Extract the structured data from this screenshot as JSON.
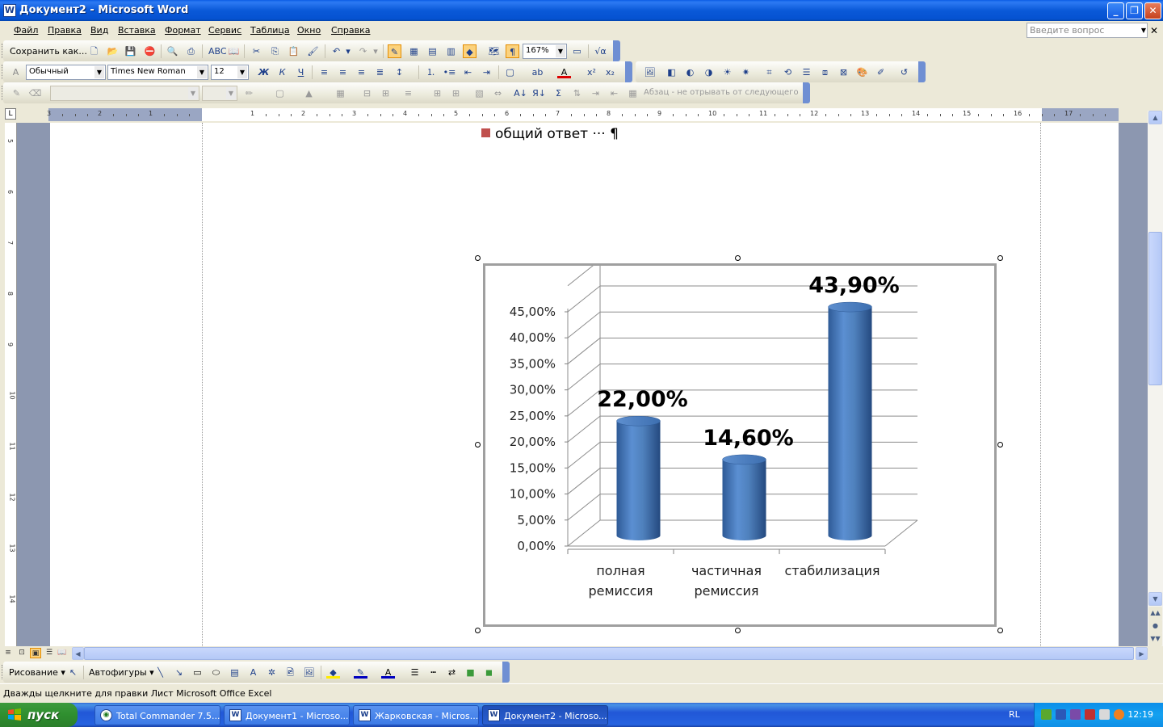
{
  "window": {
    "title": "Документ2 - Microsoft Word"
  },
  "menu": [
    "Файл",
    "Правка",
    "Вид",
    "Вставка",
    "Формат",
    "Сервис",
    "Таблица",
    "Окно",
    "Справка"
  ],
  "ask_placeholder": "Введите вопрос",
  "toolbar1": {
    "save_as": "Сохранить как...",
    "zoom": "167%"
  },
  "toolbar2": {
    "style": "Обычный",
    "font": "Times New Roman",
    "size": "12"
  },
  "toolbar3": {
    "keep_with_next": "Абзац - не отрывать от следующего"
  },
  "document": {
    "legend_text": "общий ответ ··· ¶"
  },
  "chart_data": {
    "type": "bar",
    "style": "3d-cylinder",
    "categories": [
      "полная ремиссия",
      "частичная ремиссия",
      "стабилизация"
    ],
    "category_lines": [
      [
        "полная",
        "ремиссия"
      ],
      [
        "частичная",
        "ремиссия"
      ],
      [
        "стабилизация"
      ]
    ],
    "series": [
      {
        "name": "общий ответ",
        "values": [
          22.0,
          14.6,
          43.9
        ]
      }
    ],
    "data_labels": [
      "22,00%",
      "14,60%",
      "43,90%"
    ],
    "ytick_labels": [
      "0,00%",
      "5,00%",
      "10,00%",
      "15,00%",
      "20,00%",
      "25,00%",
      "30,00%",
      "35,00%",
      "40,00%",
      "45,00%"
    ],
    "ylim": [
      0,
      45
    ],
    "grid": true,
    "colors": {
      "bar": "#4f81bd"
    }
  },
  "drawing_toolbar": {
    "draw": "Рисование",
    "autoshapes": "Автофигуры"
  },
  "status_text": "Дважды щелкните для правки Лист Microsoft Office Excel",
  "taskbar": {
    "start": "пуск",
    "tasks": [
      "Total Commander 7.5...",
      "Документ1 - Microso...",
      "Жарковская - Micros...",
      "Документ2 - Microso..."
    ],
    "lang": "RL",
    "time": "12:19"
  }
}
